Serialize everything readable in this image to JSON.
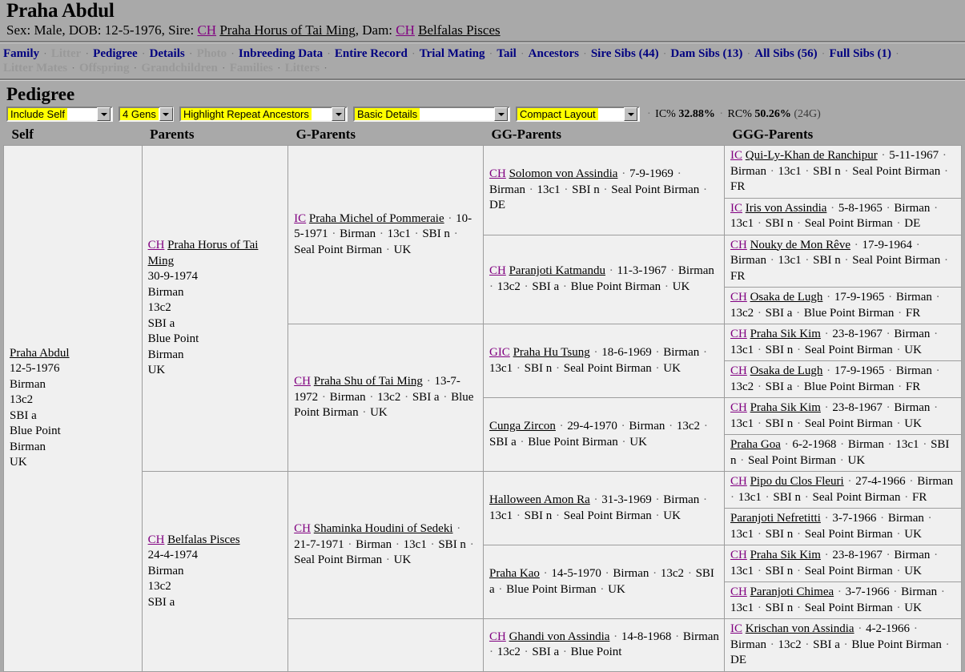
{
  "header": {
    "pet_name": "Praha Abdul",
    "sub": {
      "sex_label": "Sex: Male, DOB: 12-5-1976, Sire: ",
      "sire_title": "CH",
      "sire_name": "Praha Horus of Tai Ming",
      "dam_label": ", Dam: ",
      "dam_title": "CH",
      "dam_name": "Belfalas Pisces"
    }
  },
  "nav": {
    "row1": [
      {
        "label": "Family",
        "dim": false
      },
      {
        "label": "Litter",
        "dim": true
      },
      {
        "label": "Pedigree",
        "dim": false
      },
      {
        "label": "Details",
        "dim": false
      },
      {
        "label": "Photo",
        "dim": true
      },
      {
        "label": "Inbreeding Data",
        "dim": false
      },
      {
        "label": "Entire Record",
        "dim": false
      },
      {
        "label": "Trial Mating",
        "dim": false
      },
      {
        "label": "Tail",
        "dim": false
      },
      {
        "label": "Ancestors",
        "dim": false
      },
      {
        "label": "Sire Sibs (44)",
        "dim": false
      },
      {
        "label": "Dam Sibs (13)",
        "dim": false
      },
      {
        "label": "All Sibs (56)",
        "dim": false
      },
      {
        "label": "Full Sibs (1)",
        "dim": false
      }
    ],
    "row2": [
      {
        "label": "Litter Mates",
        "dim": true
      },
      {
        "label": "Offspring",
        "dim": true
      },
      {
        "label": "Grandchildren",
        "dim": true
      },
      {
        "label": "Families",
        "dim": true
      },
      {
        "label": "Litters",
        "dim": true
      }
    ],
    "separator": "·"
  },
  "pedigree": {
    "title": "Pedigree",
    "controls": {
      "include": "Include Self",
      "gens": "4 Gens",
      "highlight": "Highlight Repeat Ancestors",
      "details": "Basic Details",
      "layout": "Compact Layout"
    },
    "stats": {
      "ic_label": "IC%",
      "ic_value": "32.88%",
      "rc_label": "RC%",
      "rc_value": "50.26%",
      "gens": "(24G)",
      "sep": "·"
    },
    "columns": [
      "Self",
      "Parents",
      "G-Parents",
      "GG-Parents",
      "GGG-Parents"
    ],
    "self": {
      "title": "",
      "name": "Praha Abdul",
      "lines": [
        "12-5-1976",
        "Birman",
        "13c2",
        "SBI a",
        "Blue Point",
        "Birman",
        "UK"
      ]
    },
    "parents": [
      {
        "title": "CH",
        "name": "Praha Horus of Tai Ming",
        "lines": [
          "30-9-1974",
          "Birman",
          "13c2",
          "SBI a",
          "Blue Point",
          "Birman",
          "UK"
        ]
      },
      {
        "title": "CH",
        "name": "Belfalas Pisces",
        "lines": [
          "24-4-1974",
          "Birman",
          "13c2",
          "SBI a"
        ]
      }
    ],
    "gparents": [
      {
        "title": "IC",
        "name": "Praha Michel of Pommeraie",
        "details": [
          "10-5-1971",
          "Birman",
          "13c1",
          "SBI n",
          "Seal Point Birman",
          "UK"
        ],
        "highlight": "none"
      },
      {
        "title": "CH",
        "name": "Praha Shu of Tai Ming",
        "details": [
          "13-7-1972",
          "Birman",
          "13c2",
          "SBI a",
          "Blue Point Birman",
          "UK"
        ],
        "highlight": "none"
      },
      {
        "title": "CH",
        "name": "Shaminka Houdini of Sedeki",
        "details": [
          "21-7-1971",
          "Birman",
          "13c1",
          "SBI n",
          "Seal Point Birman",
          "UK"
        ],
        "highlight": "none"
      },
      {
        "title": "",
        "name": "",
        "details": [],
        "highlight": "none"
      }
    ],
    "ggparents": [
      {
        "title": "CH",
        "name": "Solomon von Assindia",
        "details": [
          "7-9-1969",
          "Birman",
          "13c1",
          "SBI n",
          "Seal Point Birman",
          "DE"
        ],
        "highlight": "none"
      },
      {
        "title": "CH",
        "name": "Paranjoti Katmandu",
        "details": [
          "11-3-1967",
          "Birman",
          "13c2",
          "SBI a",
          "Blue Point Birman",
          "UK"
        ],
        "highlight": "none"
      },
      {
        "title": "GIC",
        "name": "Praha Hu Tsung",
        "details": [
          "18-6-1969",
          "Birman",
          "13c1",
          "SBI n",
          "Seal Point Birman",
          "UK"
        ],
        "highlight": "none"
      },
      {
        "title": "",
        "name": "Cunga Zircon",
        "details": [
          "29-4-1970",
          "Birman",
          "13c2",
          "SBI a",
          "Blue Point Birman",
          "UK"
        ],
        "highlight": "none"
      },
      {
        "title": "",
        "name": "Halloween Amon Ra",
        "details": [
          "31-3-1969",
          "Birman",
          "13c1",
          "SBI n",
          "Seal Point Birman",
          "UK"
        ],
        "highlight": "none"
      },
      {
        "title": "",
        "name": "Praha Kao",
        "details": [
          "14-5-1970",
          "Birman",
          "13c2",
          "SBI a",
          "Blue Point Birman",
          "UK"
        ],
        "highlight": "none"
      },
      {
        "title": "CH",
        "name": "Ghandi von Assindia",
        "details": [
          "14-8-1968",
          "Birman",
          "13c2",
          "SBI a",
          "Blue Point"
        ],
        "highlight": "none"
      }
    ],
    "gggparents": [
      {
        "title": "IC",
        "name": "Qui-Ly-Khan de Ranchipur",
        "details": [
          "5-11-1967",
          "Birman",
          "13c1",
          "SBI n",
          "Seal Point Birman",
          "FR"
        ],
        "highlight": "none"
      },
      {
        "title": "IC",
        "name": "Iris von Assindia",
        "details": [
          "5-8-1965",
          "Birman",
          "13c1",
          "SBI n",
          "Seal Point Birman",
          "DE"
        ],
        "highlight": "none"
      },
      {
        "title": "CH",
        "name": "Nouky de Mon Rêve",
        "details": [
          "17-9-1964",
          "Birman",
          "13c1",
          "SBI n",
          "Seal Point Birman",
          "FR"
        ],
        "highlight": "none"
      },
      {
        "title": "CH",
        "name": "Osaka de Lugh",
        "details": [
          "17-9-1965",
          "Birman",
          "13c2",
          "SBI a",
          "Blue Point Birman",
          "FR"
        ],
        "highlight": "blue"
      },
      {
        "title": "CH",
        "name": "Praha Sik Kim",
        "details": [
          "23-8-1967",
          "Birman",
          "13c1",
          "SBI n",
          "Seal Point Birman",
          "UK"
        ],
        "highlight": "pink"
      },
      {
        "title": "CH",
        "name": "Osaka de Lugh",
        "details": [
          "17-9-1965",
          "Birman",
          "13c2",
          "SBI a",
          "Blue Point Birman",
          "FR"
        ],
        "highlight": "blue"
      },
      {
        "title": "CH",
        "name": "Praha Sik Kim",
        "details": [
          "23-8-1967",
          "Birman",
          "13c1",
          "SBI n",
          "Seal Point Birman",
          "UK"
        ],
        "highlight": "pink"
      },
      {
        "title": "",
        "name": "Praha Goa",
        "details": [
          "6-2-1968",
          "Birman",
          "13c1",
          "SBI n",
          "Seal Point Birman",
          "UK"
        ],
        "highlight": "none"
      },
      {
        "title": "CH",
        "name": "Pipo du Clos Fleuri",
        "details": [
          "27-4-1966",
          "Birman",
          "13c1",
          "SBI n",
          "Seal Point Birman",
          "FR"
        ],
        "highlight": "none"
      },
      {
        "title": "",
        "name": "Paranjoti Nefretitti",
        "details": [
          "3-7-1966",
          "Birman",
          "13c1",
          "SBI n",
          "Seal Point Birman",
          "UK"
        ],
        "highlight": "none"
      },
      {
        "title": "CH",
        "name": "Praha Sik Kim",
        "details": [
          "23-8-1967",
          "Birman",
          "13c1",
          "SBI n",
          "Seal Point Birman",
          "UK"
        ],
        "highlight": "pink"
      },
      {
        "title": "CH",
        "name": "Paranjoti Chimea",
        "details": [
          "3-7-1966",
          "Birman",
          "13c1",
          "SBI n",
          "Seal Point Birman",
          "UK"
        ],
        "highlight": "none"
      },
      {
        "title": "IC",
        "name": "Krischan von Assindia",
        "details": [
          "4-2-1966",
          "Birman",
          "13c2",
          "SBI a",
          "Blue Point Birman",
          "DE"
        ],
        "highlight": "none"
      }
    ]
  },
  "colors": {
    "page_bg": "#a9a9a9",
    "cell_bg": "#f0f0f0",
    "link": "#000080",
    "title_prefix": "#800080",
    "highlight_blue": "#ccccf5",
    "highlight_pink": "#fccdcd",
    "control_highlight": "#ffff00"
  }
}
